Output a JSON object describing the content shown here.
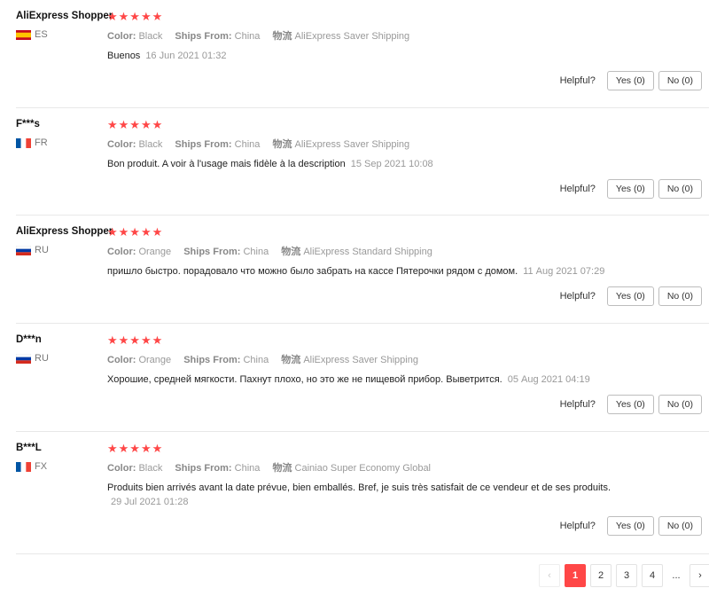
{
  "reviews": [
    {
      "user": "AliExpress Shopper",
      "country_code": "ES",
      "flag": "es",
      "stars": "★★★★★",
      "rating": 5,
      "color_key": "Color:",
      "color_val": "Black",
      "ships_key": "Ships From:",
      "ships_val": "China",
      "logistics_key": "物流",
      "logistics_val": "AliExpress Saver Shipping",
      "text": "Buenos",
      "date": "16 Jun 2021 01:32",
      "helpful": "Helpful?",
      "yes": "Yes (0)",
      "no": "No (0)"
    },
    {
      "user": "F***s",
      "country_code": "FR",
      "flag": "fr",
      "stars": "★★★★★",
      "rating": 5,
      "color_key": "Color:",
      "color_val": "Black",
      "ships_key": "Ships From:",
      "ships_val": "China",
      "logistics_key": "物流",
      "logistics_val": "AliExpress Saver Shipping",
      "text": "Bon produit. A voir à l'usage mais fidèle à la description",
      "date": "15 Sep 2021 10:08",
      "helpful": "Helpful?",
      "yes": "Yes (0)",
      "no": "No (0)"
    },
    {
      "user": "AliExpress Shopper",
      "country_code": "RU",
      "flag": "ru",
      "stars": "★★★★★",
      "rating": 5,
      "color_key": "Color:",
      "color_val": "Orange",
      "ships_key": "Ships From:",
      "ships_val": "China",
      "logistics_key": "物流",
      "logistics_val": "AliExpress Standard Shipping",
      "text": "пришло быстро. порадовало что можно было забрать на кассе Пятерочки рядом с домом.",
      "date": "11 Aug 2021 07:29",
      "helpful": "Helpful?",
      "yes": "Yes (0)",
      "no": "No (0)"
    },
    {
      "user": "D***n",
      "country_code": "RU",
      "flag": "ru",
      "stars": "★★★★★",
      "rating": 5,
      "color_key": "Color:",
      "color_val": "Orange",
      "ships_key": "Ships From:",
      "ships_val": "China",
      "logistics_key": "物流",
      "logistics_val": "AliExpress Saver Shipping",
      "text": "Хорошие, средней мягкости. Пахнут плохо, но это же не пищевой прибор. Выветрится.",
      "date": "05 Aug 2021 04:19",
      "helpful": "Helpful?",
      "yes": "Yes (0)",
      "no": "No (0)"
    },
    {
      "user": "B***L",
      "country_code": "FX",
      "flag": "fr",
      "stars": "★★★★★",
      "rating": 5,
      "color_key": "Color:",
      "color_val": "Black",
      "ships_key": "Ships From:",
      "ships_val": "China",
      "logistics_key": "物流",
      "logistics_val": "Cainiao Super Economy Global",
      "text": "Produits bien arrivés avant la date prévue, bien emballés. Bref, je suis très satisfait de ce vendeur et de ses produits.",
      "date": "29 Jul 2021 01:28",
      "helpful": "Helpful?",
      "yes": "Yes (0)",
      "no": "No (0)"
    }
  ],
  "pagination": {
    "prev_icon": "chevron-left-icon",
    "prev": "‹",
    "pages": [
      "1",
      "2",
      "3",
      "4"
    ],
    "current": "1",
    "ellipsis": "...",
    "next_icon": "chevron-right-icon",
    "next": "›"
  },
  "colors": {
    "accent": "#ff4747",
    "muted": "#999999",
    "border": "#e8e8e8"
  }
}
